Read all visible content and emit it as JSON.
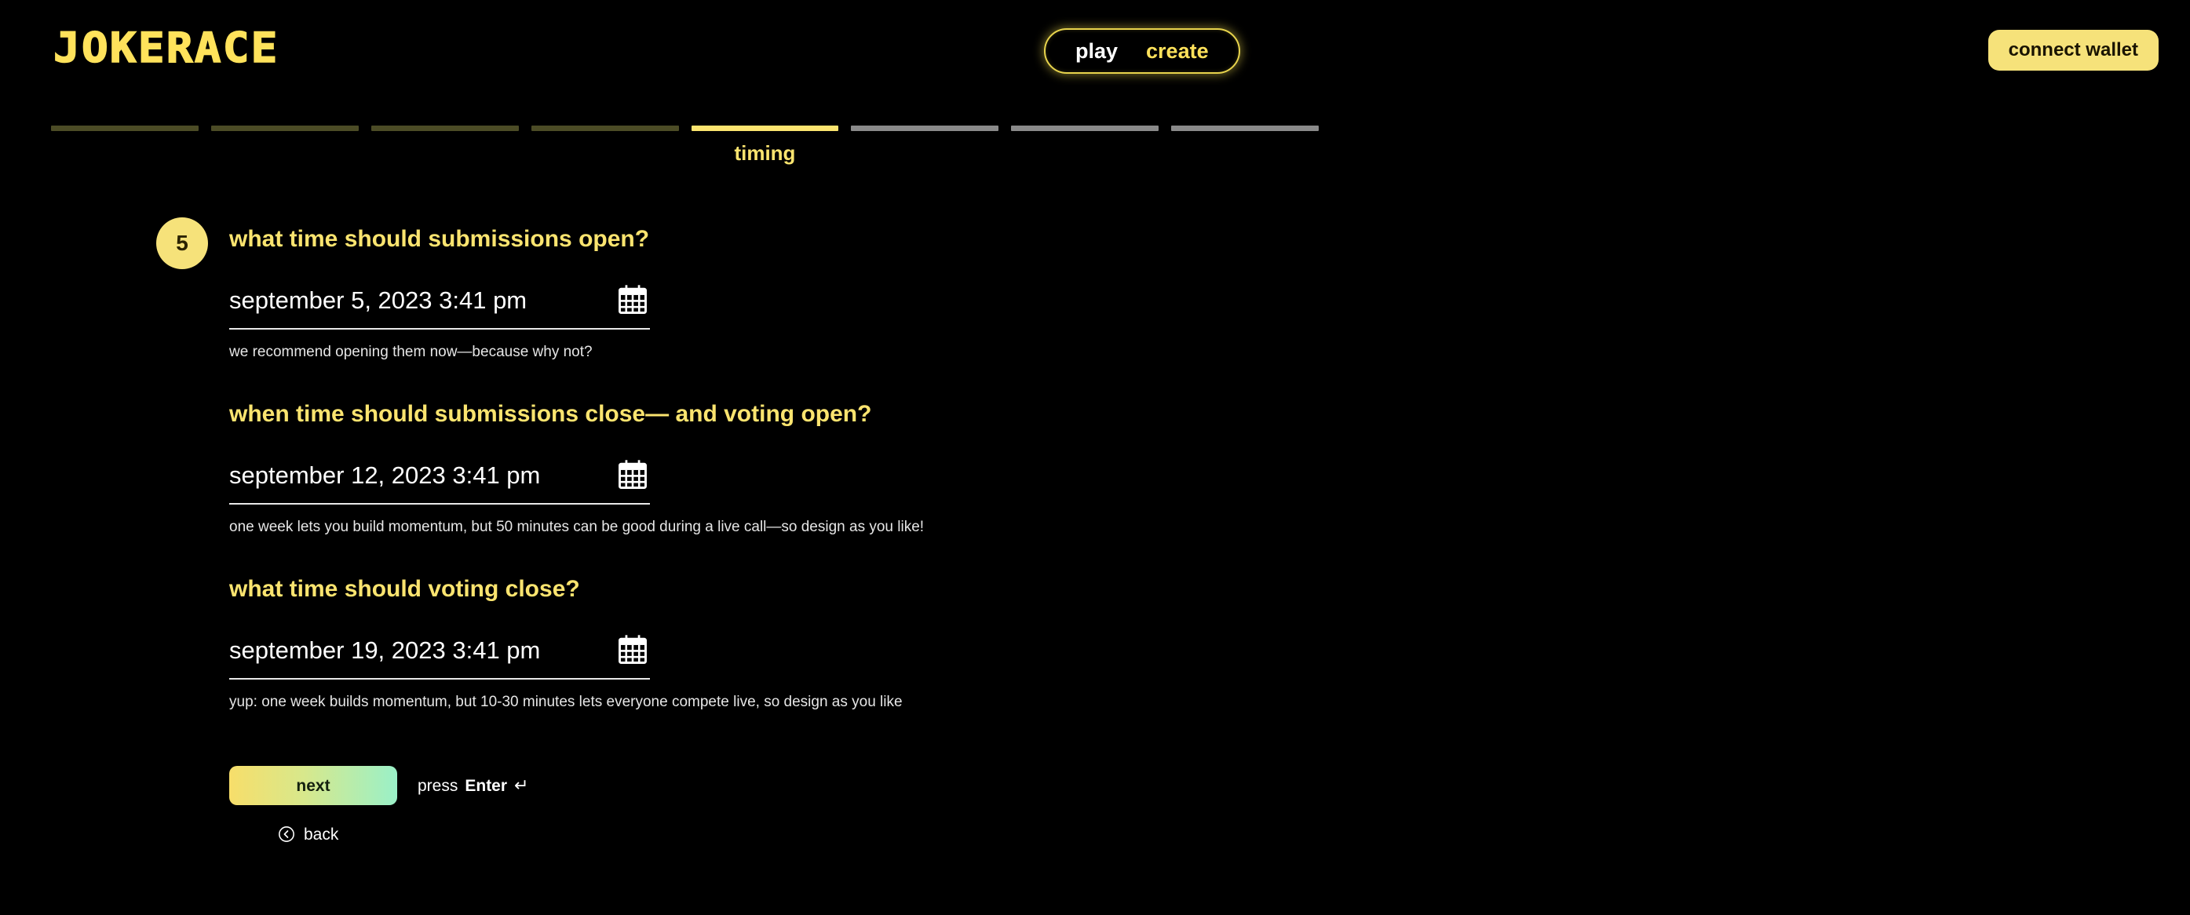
{
  "brand": {
    "logo": "JOKERACE"
  },
  "nav": {
    "play_label": "play",
    "create_label": "create",
    "connect_wallet_label": "connect wallet"
  },
  "stepper": {
    "active_label": "timing",
    "total_steps": 8,
    "active_index": 5,
    "colors": {
      "done": "#4c4c26",
      "active": "#FBE46F",
      "todo": "#8a8a8a"
    },
    "segments": [
      {
        "state": "done"
      },
      {
        "state": "done"
      },
      {
        "state": "done"
      },
      {
        "state": "done"
      },
      {
        "state": "active"
      },
      {
        "state": "todo"
      },
      {
        "state": "todo"
      },
      {
        "state": "todo"
      }
    ]
  },
  "form": {
    "step_number": "5",
    "questions": [
      {
        "title": "what time should submissions open?",
        "value": "september 5, 2023 3:41 pm",
        "hint": "we recommend opening them now—because why not?",
        "icon": "calendar-icon"
      },
      {
        "title": "when time should submissions close— and voting open?",
        "value": "september 12, 2023 3:41 pm",
        "hint": "one week lets you build momentum, but 50 minutes can be good during a live call—so design as you like!",
        "icon": "calendar-icon"
      },
      {
        "title": "what time should voting close?",
        "value": "september 19, 2023 3:41 pm",
        "hint": "yup: one week builds momentum, but 10-30 minutes lets everyone compete live, so design as you like",
        "icon": "calendar-icon"
      }
    ],
    "next_label": "next",
    "press_enter_prefix": "press ",
    "press_enter_key": "Enter",
    "press_enter_glyph": "↵",
    "back_label": "back"
  },
  "theme": {
    "background": "#000000",
    "accent_yellow": "#FBE46F",
    "logo_yellow": "#FFE25B",
    "button_gradient_start": "#F7DE6A",
    "button_gradient_end": "#9AF0C8"
  }
}
